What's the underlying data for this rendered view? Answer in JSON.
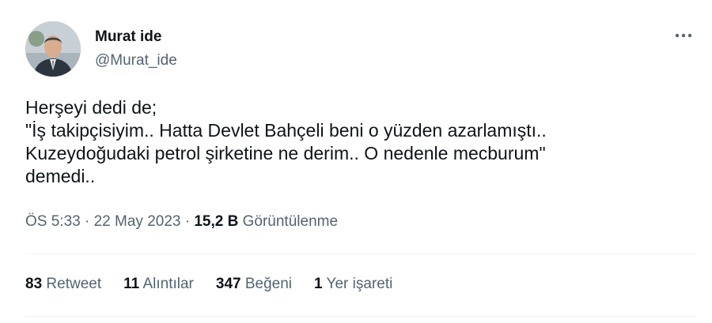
{
  "author": {
    "display_name": "Murat ide",
    "handle": "@Murat_ide"
  },
  "tweet": {
    "lines": [
      "Herşeyi dedi de;",
      "\"İş takipçisiyim.. Hatta Devlet Bahçeli beni o yüzden azarlamıştı..",
      "Kuzeydoğudaki petrol şirketine ne derim.. O nedenle mecburum\"",
      "demedi.."
    ]
  },
  "meta": {
    "time": "ÖS 5:33",
    "separator": " · ",
    "date": "22 May 2023",
    "views_count": "15,2 B",
    "views_label": " Görüntülenme"
  },
  "stats": {
    "retweets": {
      "count": "83",
      "label": " Retweet"
    },
    "quotes": {
      "count": "11",
      "label": " Alıntılar"
    },
    "likes": {
      "count": "347",
      "label": " Beğeni"
    },
    "bookmarks": {
      "count": "1",
      "label": " Yer işareti"
    }
  },
  "icons": {
    "more": "more-horizontal-icon"
  },
  "colors": {
    "text_primary": "#0f1419",
    "text_secondary": "#536471",
    "divider": "#eff3f4"
  }
}
